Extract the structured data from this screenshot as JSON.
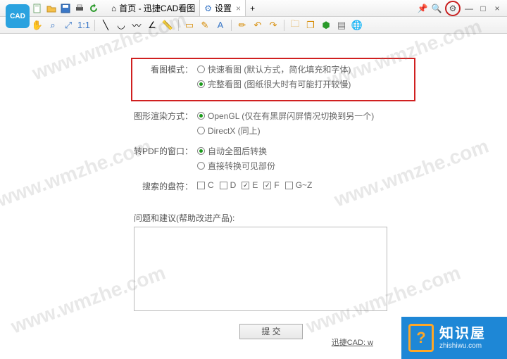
{
  "watermark": "www.wmzhe.com",
  "titlebar": {
    "tab_home": "首页 - 迅捷CAD看图",
    "tab_settings": "设置",
    "add_tab": "+"
  },
  "toolbar_icons": [
    "new-icon",
    "open-icon",
    "save-icon",
    "print-icon",
    "refresh-icon",
    "hand-icon",
    "zoom-area-icon",
    "zoom-fit-icon",
    "zoom-real-icon",
    "line-icon",
    "arc-icon",
    "polyline-icon",
    "angle-icon",
    "ruler-icon",
    "rect-icon",
    "note-icon",
    "text-icon",
    "draw-icon",
    "undo-icon",
    "redo-icon",
    "folder-icon",
    "layers-icon",
    "cube-icon",
    "sheets-icon",
    "globe-icon"
  ],
  "settings": {
    "view_mode": {
      "label": "看图模式：",
      "options": [
        {
          "text": "快速看图 (默认方式，简化填充和字体)",
          "selected": false
        },
        {
          "text": "完整看图 (图纸很大时有可能打开较慢)",
          "selected": true
        }
      ]
    },
    "render_mode": {
      "label": "图形渲染方式：",
      "options": [
        {
          "text": "OpenGL (仅在有黑屏闪屏情况切换到另一个)",
          "selected": true
        },
        {
          "text": "DirectX (同上)",
          "selected": false
        }
      ]
    },
    "pdf_window": {
      "label": "转PDF的窗口：",
      "options": [
        {
          "text": "自动全图后转换",
          "selected": true
        },
        {
          "text": "直接转换可见部份",
          "selected": false
        }
      ]
    },
    "drives": {
      "label": "搜索的盘符：",
      "items": [
        {
          "name": "C",
          "checked": false
        },
        {
          "name": "D",
          "checked": false
        },
        {
          "name": "E",
          "checked": true
        },
        {
          "name": "F",
          "checked": true
        },
        {
          "name": "G~Z",
          "checked": false
        }
      ]
    },
    "feedback_label": "问题和建议(帮助改进产品):",
    "submit": "提 交"
  },
  "footer": {
    "text": "迅捷CAD: w"
  },
  "brand": {
    "main": "知识屋",
    "sub": "zhishiwu.com"
  }
}
